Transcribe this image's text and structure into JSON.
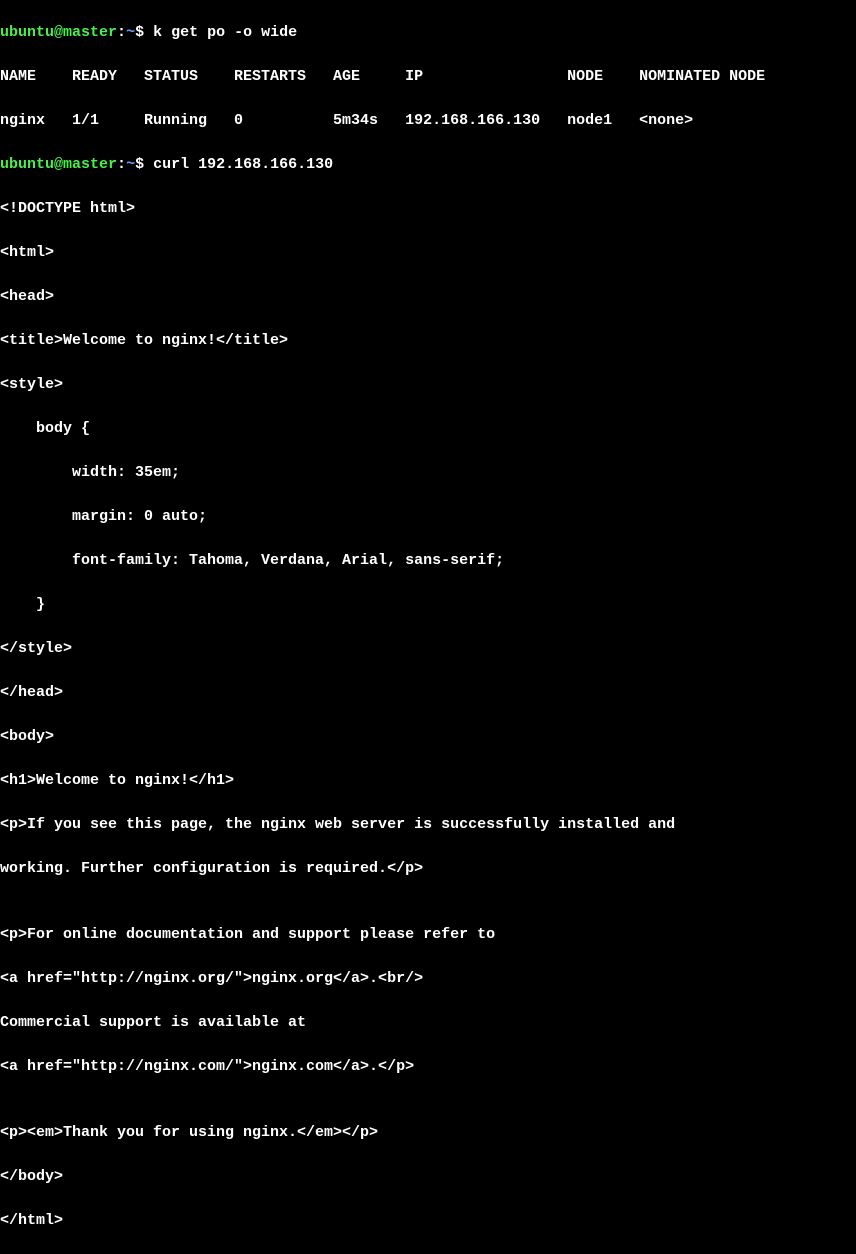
{
  "prompt1": {
    "user": "ubuntu",
    "at": "@",
    "host": "master",
    "colon": ":",
    "path": "~",
    "dollar": "$ ",
    "cmd": "k get po -o wide"
  },
  "table": {
    "header": "NAME    READY   STATUS    RESTARTS   AGE     IP                NODE    NOMINATED NODE",
    "row": "nginx   1/1     Running   0          5m34s   192.168.166.130   node1   <none>"
  },
  "prompt2": {
    "user": "ubuntu",
    "at": "@",
    "host": "master",
    "colon": ":",
    "path": "~",
    "dollar": "$ ",
    "cmd": "curl 192.168.166.130"
  },
  "curl": {
    "l1": "<!DOCTYPE html>",
    "l2": "<html>",
    "l3": "<head>",
    "l4": "<title>Welcome to nginx!</title>",
    "l5": "<style>",
    "l6": "    body {",
    "l7": "        width: 35em;",
    "l8": "        margin: 0 auto;",
    "l9": "        font-family: Tahoma, Verdana, Arial, sans-serif;",
    "l10": "    }",
    "l11": "</style>",
    "l12": "</head>",
    "l13": "<body>",
    "l14": "<h1>Welcome to nginx!</h1>",
    "l15": "<p>If you see this page, the nginx web server is successfully installed and",
    "l16": "working. Further configuration is required.</p>",
    "l17": "",
    "l18": "<p>For online documentation and support please refer to",
    "l19": "<a href=\"http://nginx.org/\">nginx.org</a>.<br/>",
    "l20": "Commercial support is available at",
    "l21": "<a href=\"http://nginx.com/\">nginx.com</a>.</p>",
    "l22": "",
    "l23": "<p><em>Thank you for using nginx.</em></p>",
    "l24": "</body>",
    "l25": "</html>"
  },
  "chart_data": {
    "type": "table",
    "title": "k get po -o wide",
    "columns": [
      "NAME",
      "READY",
      "STATUS",
      "RESTARTS",
      "AGE",
      "IP",
      "NODE",
      "NOMINATED NODE"
    ],
    "rows": [
      [
        "nginx",
        "1/1",
        "Running",
        "0",
        "5m34s",
        "192.168.166.130",
        "node1",
        "<none>"
      ]
    ]
  }
}
